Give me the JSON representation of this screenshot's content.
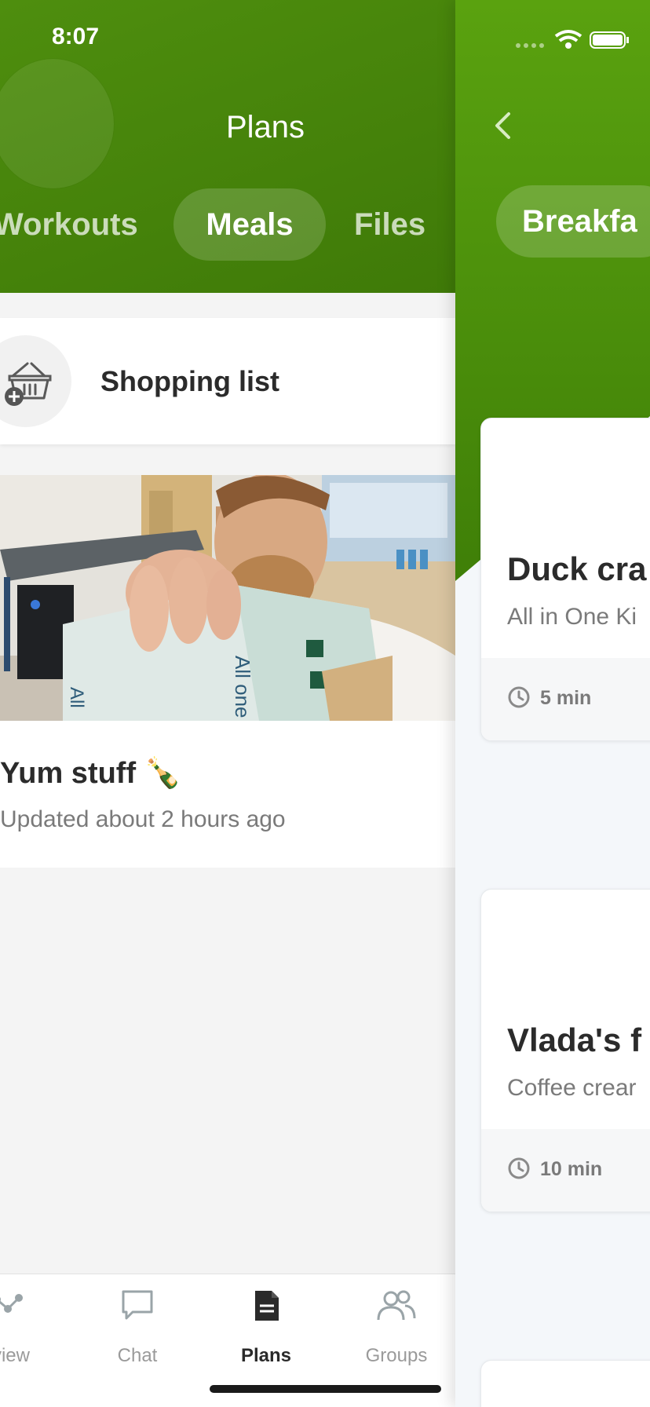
{
  "status_bar": {
    "time": "8:07"
  },
  "left_screen": {
    "title": "Plans",
    "tabs": [
      {
        "label": "Workouts",
        "active": false
      },
      {
        "label": "Meals",
        "active": true
      },
      {
        "label": "Files",
        "active": false
      }
    ],
    "shopping_list": {
      "label": "Shopping list",
      "icon": "basket-add-icon"
    },
    "plan": {
      "name": "Yum stuff 🍾",
      "updated": "Updated about 2 hours ago",
      "image": "man-holding-crackers-bag-photo"
    },
    "tab_bar": [
      {
        "label": "rview",
        "icon": "overview-icon",
        "active": false
      },
      {
        "label": "Chat",
        "icon": "chat-icon",
        "active": false
      },
      {
        "label": "Plans",
        "icon": "document-icon",
        "active": true
      },
      {
        "label": "Groups",
        "icon": "groups-icon",
        "active": false
      }
    ]
  },
  "right_screen": {
    "category_pill": "Breakfa",
    "recipes": [
      {
        "title": "Duck cra",
        "subtitle": "All in One Ki",
        "time": "5 min"
      },
      {
        "title": "Vlada's f",
        "subtitle": "Coffee crear",
        "time": "10 min"
      }
    ]
  },
  "colors": {
    "header_green": "#3f7a08",
    "header_green_light": "#5aa20f",
    "text_dark": "#2b2b2b",
    "text_muted": "#7a7a7a",
    "background": "#f4f4f4"
  }
}
